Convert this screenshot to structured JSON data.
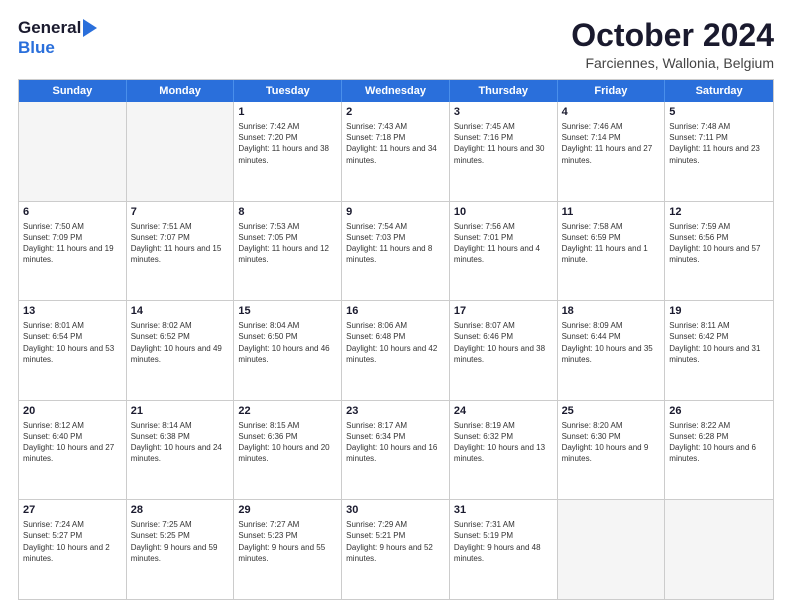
{
  "header": {
    "logo_general": "General",
    "logo_blue": "Blue",
    "month_title": "October 2024",
    "location": "Farciennes, Wallonia, Belgium"
  },
  "calendar": {
    "days_of_week": [
      "Sunday",
      "Monday",
      "Tuesday",
      "Wednesday",
      "Thursday",
      "Friday",
      "Saturday"
    ],
    "weeks": [
      [
        {
          "day": "",
          "text": "",
          "empty": true
        },
        {
          "day": "",
          "text": "",
          "empty": true
        },
        {
          "day": "1",
          "text": "Sunrise: 7:42 AM\nSunset: 7:20 PM\nDaylight: 11 hours and 38 minutes."
        },
        {
          "day": "2",
          "text": "Sunrise: 7:43 AM\nSunset: 7:18 PM\nDaylight: 11 hours and 34 minutes."
        },
        {
          "day": "3",
          "text": "Sunrise: 7:45 AM\nSunset: 7:16 PM\nDaylight: 11 hours and 30 minutes."
        },
        {
          "day": "4",
          "text": "Sunrise: 7:46 AM\nSunset: 7:14 PM\nDaylight: 11 hours and 27 minutes."
        },
        {
          "day": "5",
          "text": "Sunrise: 7:48 AM\nSunset: 7:11 PM\nDaylight: 11 hours and 23 minutes."
        }
      ],
      [
        {
          "day": "6",
          "text": "Sunrise: 7:50 AM\nSunset: 7:09 PM\nDaylight: 11 hours and 19 minutes."
        },
        {
          "day": "7",
          "text": "Sunrise: 7:51 AM\nSunset: 7:07 PM\nDaylight: 11 hours and 15 minutes."
        },
        {
          "day": "8",
          "text": "Sunrise: 7:53 AM\nSunset: 7:05 PM\nDaylight: 11 hours and 12 minutes."
        },
        {
          "day": "9",
          "text": "Sunrise: 7:54 AM\nSunset: 7:03 PM\nDaylight: 11 hours and 8 minutes."
        },
        {
          "day": "10",
          "text": "Sunrise: 7:56 AM\nSunset: 7:01 PM\nDaylight: 11 hours and 4 minutes."
        },
        {
          "day": "11",
          "text": "Sunrise: 7:58 AM\nSunset: 6:59 PM\nDaylight: 11 hours and 1 minute."
        },
        {
          "day": "12",
          "text": "Sunrise: 7:59 AM\nSunset: 6:56 PM\nDaylight: 10 hours and 57 minutes."
        }
      ],
      [
        {
          "day": "13",
          "text": "Sunrise: 8:01 AM\nSunset: 6:54 PM\nDaylight: 10 hours and 53 minutes."
        },
        {
          "day": "14",
          "text": "Sunrise: 8:02 AM\nSunset: 6:52 PM\nDaylight: 10 hours and 49 minutes."
        },
        {
          "day": "15",
          "text": "Sunrise: 8:04 AM\nSunset: 6:50 PM\nDaylight: 10 hours and 46 minutes."
        },
        {
          "day": "16",
          "text": "Sunrise: 8:06 AM\nSunset: 6:48 PM\nDaylight: 10 hours and 42 minutes."
        },
        {
          "day": "17",
          "text": "Sunrise: 8:07 AM\nSunset: 6:46 PM\nDaylight: 10 hours and 38 minutes."
        },
        {
          "day": "18",
          "text": "Sunrise: 8:09 AM\nSunset: 6:44 PM\nDaylight: 10 hours and 35 minutes."
        },
        {
          "day": "19",
          "text": "Sunrise: 8:11 AM\nSunset: 6:42 PM\nDaylight: 10 hours and 31 minutes."
        }
      ],
      [
        {
          "day": "20",
          "text": "Sunrise: 8:12 AM\nSunset: 6:40 PM\nDaylight: 10 hours and 27 minutes."
        },
        {
          "day": "21",
          "text": "Sunrise: 8:14 AM\nSunset: 6:38 PM\nDaylight: 10 hours and 24 minutes."
        },
        {
          "day": "22",
          "text": "Sunrise: 8:15 AM\nSunset: 6:36 PM\nDaylight: 10 hours and 20 minutes."
        },
        {
          "day": "23",
          "text": "Sunrise: 8:17 AM\nSunset: 6:34 PM\nDaylight: 10 hours and 16 minutes."
        },
        {
          "day": "24",
          "text": "Sunrise: 8:19 AM\nSunset: 6:32 PM\nDaylight: 10 hours and 13 minutes."
        },
        {
          "day": "25",
          "text": "Sunrise: 8:20 AM\nSunset: 6:30 PM\nDaylight: 10 hours and 9 minutes."
        },
        {
          "day": "26",
          "text": "Sunrise: 8:22 AM\nSunset: 6:28 PM\nDaylight: 10 hours and 6 minutes."
        }
      ],
      [
        {
          "day": "27",
          "text": "Sunrise: 7:24 AM\nSunset: 5:27 PM\nDaylight: 10 hours and 2 minutes."
        },
        {
          "day": "28",
          "text": "Sunrise: 7:25 AM\nSunset: 5:25 PM\nDaylight: 9 hours and 59 minutes."
        },
        {
          "day": "29",
          "text": "Sunrise: 7:27 AM\nSunset: 5:23 PM\nDaylight: 9 hours and 55 minutes."
        },
        {
          "day": "30",
          "text": "Sunrise: 7:29 AM\nSunset: 5:21 PM\nDaylight: 9 hours and 52 minutes."
        },
        {
          "day": "31",
          "text": "Sunrise: 7:31 AM\nSunset: 5:19 PM\nDaylight: 9 hours and 48 minutes."
        },
        {
          "day": "",
          "text": "",
          "empty": true
        },
        {
          "day": "",
          "text": "",
          "empty": true
        }
      ]
    ]
  }
}
